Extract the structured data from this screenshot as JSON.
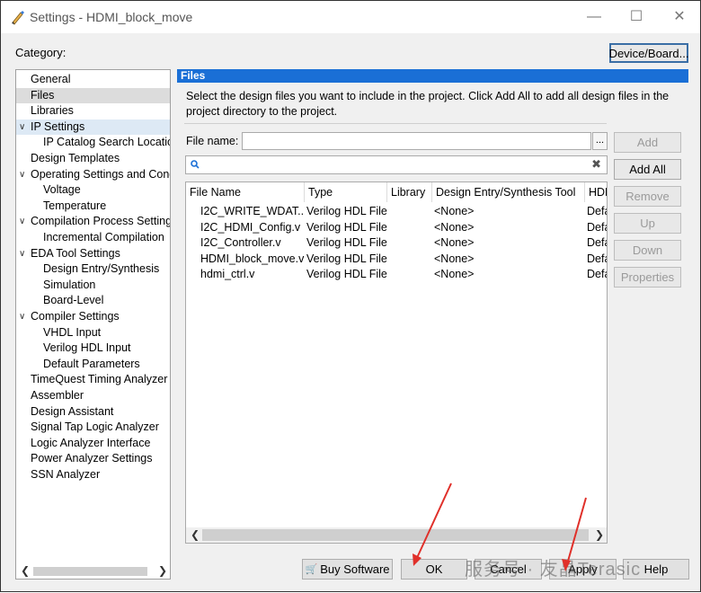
{
  "window": {
    "title": "Settings - HDMI_block_move",
    "accent": "#1a6fd6"
  },
  "category_label": "Category:",
  "device_board_label": "Device/Board...",
  "tree": [
    {
      "label": "General",
      "indent": 0,
      "arrow": ""
    },
    {
      "label": "Files",
      "indent": 0,
      "arrow": "",
      "selected": true
    },
    {
      "label": "Libraries",
      "indent": 0,
      "arrow": ""
    },
    {
      "label": "IP Settings",
      "indent": 0,
      "arrow": "v",
      "highlighted": true
    },
    {
      "label": "IP Catalog Search Locations",
      "indent": 1,
      "arrow": ""
    },
    {
      "label": "Design Templates",
      "indent": 0,
      "arrow": ""
    },
    {
      "label": "Operating Settings and Conditions",
      "indent": 0,
      "arrow": "v"
    },
    {
      "label": "Voltage",
      "indent": 1,
      "arrow": ""
    },
    {
      "label": "Temperature",
      "indent": 1,
      "arrow": ""
    },
    {
      "label": "Compilation Process Settings",
      "indent": 0,
      "arrow": "v"
    },
    {
      "label": "Incremental Compilation",
      "indent": 1,
      "arrow": ""
    },
    {
      "label": "EDA Tool Settings",
      "indent": 0,
      "arrow": "v"
    },
    {
      "label": "Design Entry/Synthesis",
      "indent": 1,
      "arrow": ""
    },
    {
      "label": "Simulation",
      "indent": 1,
      "arrow": ""
    },
    {
      "label": "Board-Level",
      "indent": 1,
      "arrow": ""
    },
    {
      "label": "Compiler Settings",
      "indent": 0,
      "arrow": "v"
    },
    {
      "label": "VHDL Input",
      "indent": 1,
      "arrow": ""
    },
    {
      "label": "Verilog HDL Input",
      "indent": 1,
      "arrow": ""
    },
    {
      "label": "Default Parameters",
      "indent": 1,
      "arrow": ""
    },
    {
      "label": "TimeQuest Timing Analyzer",
      "indent": 0,
      "arrow": ""
    },
    {
      "label": "Assembler",
      "indent": 0,
      "arrow": ""
    },
    {
      "label": "Design Assistant",
      "indent": 0,
      "arrow": ""
    },
    {
      "label": "Signal Tap Logic Analyzer",
      "indent": 0,
      "arrow": ""
    },
    {
      "label": "Logic Analyzer Interface",
      "indent": 0,
      "arrow": ""
    },
    {
      "label": "Power Analyzer Settings",
      "indent": 0,
      "arrow": ""
    },
    {
      "label": "SSN Analyzer",
      "indent": 0,
      "arrow": ""
    }
  ],
  "files_panel": {
    "header": "Files",
    "description": "Select the design files you want to include in the project. Click Add All to add all design files in the project directory to the project.",
    "file_name_label": "File name:",
    "browse_label": "...",
    "clear_glyph": "✖",
    "columns": [
      "File Name",
      "Type",
      "Library",
      "Design Entry/Synthesis Tool",
      "HDL"
    ],
    "rows": [
      [
        "I2C_WRITE_WDAT...",
        "Verilog HDL File",
        "",
        "<None>",
        "Defa"
      ],
      [
        "I2C_HDMI_Config.v",
        "Verilog HDL File",
        "",
        "<None>",
        "Defa"
      ],
      [
        "I2C_Controller.v",
        "Verilog HDL File",
        "",
        "<None>",
        "Defa"
      ],
      [
        "HDMI_block_move.v",
        "Verilog HDL File",
        "",
        "<None>",
        "Defa"
      ],
      [
        "hdmi_ctrl.v",
        "Verilog HDL File",
        "",
        "<None>",
        "Defa"
      ]
    ]
  },
  "side_buttons": [
    {
      "label": "Add",
      "enabled": false
    },
    {
      "label": "Add All",
      "enabled": true
    },
    {
      "label": "Remove",
      "enabled": false
    },
    {
      "label": "Up",
      "enabled": false
    },
    {
      "label": "Down",
      "enabled": false
    },
    {
      "label": "Properties",
      "enabled": false
    }
  ],
  "bottom_buttons": {
    "buy_software": "Buy Software",
    "ok": "OK",
    "cancel": "Cancel",
    "apply": "Apply",
    "help": "Help"
  },
  "watermark": "服务号 · 友晶Terasic"
}
